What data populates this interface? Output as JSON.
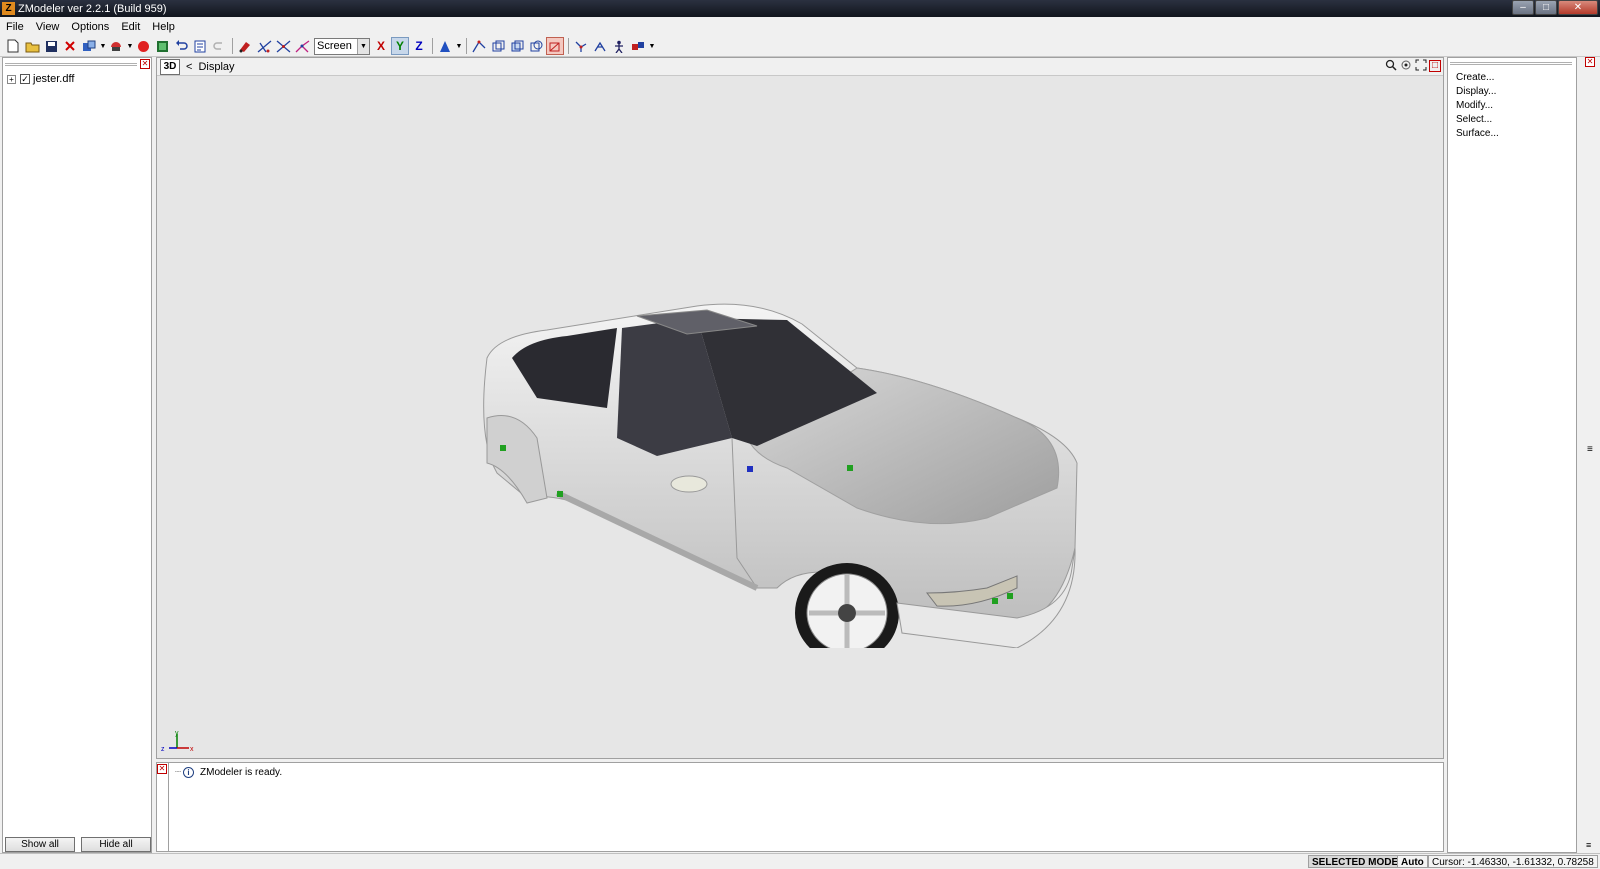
{
  "window": {
    "title": "ZModeler ver 2.2.1 (Build 959)",
    "app_icon_letter": "Z",
    "buttons": {
      "minimize": "–",
      "maximize": "□",
      "close": "✕"
    }
  },
  "menu": [
    "File",
    "View",
    "Options",
    "Edit",
    "Help"
  ],
  "toolbar": {
    "coord_system": "Screen",
    "axes": {
      "x": "X",
      "y": "Y",
      "z": "Z"
    },
    "active_axis": "Y"
  },
  "left_panel": {
    "tree": [
      {
        "label": "jester.dff",
        "expander": "+",
        "checked": true
      }
    ],
    "check_mark": "✓",
    "show_all": "Show all",
    "hide_all": "Hide all"
  },
  "viewport": {
    "mode_tag": "3D",
    "nav_back": "<",
    "nav_label": "Display",
    "gizmo_axes": {
      "y": "y",
      "z": "z",
      "x": "x"
    },
    "scene": "white sports coupe 3D model"
  },
  "right_panel": {
    "links": [
      "Create...",
      "Display...",
      "Modify...",
      "Select...",
      "Surface..."
    ]
  },
  "log": {
    "messages": [
      {
        "icon": "info",
        "glyph": "i",
        "text": "ZModeler is ready."
      }
    ]
  },
  "status": {
    "mode": "SELECTED MODE",
    "auto": "Auto",
    "cursor": "Cursor: -1.46330, -1.61332, 0.78258"
  },
  "colors": {
    "axis_x": "#c00000",
    "axis_y": "#008000",
    "axis_z": "#0000c0",
    "viewport_bg": "#e6e6e6",
    "close_red": "#c00000"
  }
}
